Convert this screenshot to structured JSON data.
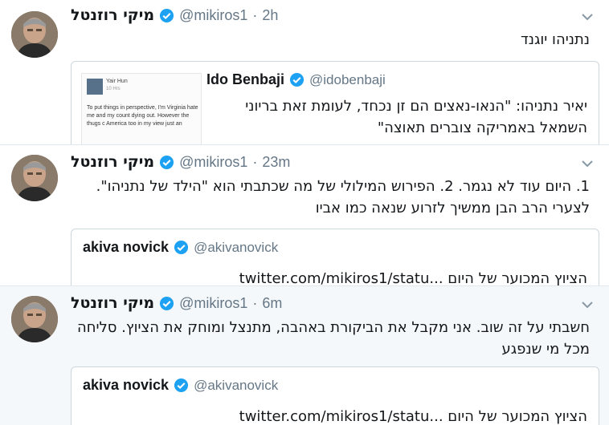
{
  "tweets": [
    {
      "author_name": "מיקי רוזנטל",
      "handle": "@mikiros1",
      "separator": "·",
      "time": "2h",
      "text": "נתניהו יוגנד",
      "quote": {
        "name": "Ido Benbaji",
        "handle": "@idobenbaji",
        "text": "יאיר נתניהו: \"הנאו-נאצים הם זן נכחד, לעומת זאת בריוני השמאל באמריקה צוברים תאוצה\"",
        "thumb": {
          "name": "Yair Hun",
          "sub": "10 Hrs",
          "text": "To put things in perspective, I'm Virginia hate me and my count dying out. However the thugs c America too in my view just an"
        }
      }
    },
    {
      "author_name": "מיקי רוזנטל",
      "handle": "@mikiros1",
      "separator": "·",
      "time": "23m",
      "text": "1. היום עוד לא נגמר. 2. הפירוש המילולי של מה שכתבתי הוא \"הילד של נתניהו\". לצערי הרב הבן ממשיך לזרוע שנאה כמו אביו",
      "quote": {
        "name": "akiva novick",
        "handle": "@akivanovick",
        "text": "הציוץ המכוער של היום ...twitter.com/mikiros1/statu"
      }
    },
    {
      "author_name": "מיקי רוזנטל",
      "handle": "@mikiros1",
      "separator": "·",
      "time": "6m",
      "text": "חשבתי על זה שוב. אני מקבל את הביקורת באהבה, מתנצל ומוחק את הציוץ. סליחה מכל מי שנפגע",
      "quote": {
        "name": "akiva novick",
        "handle": "@akivanovick",
        "text": "הציוץ המכוער של היום ...twitter.com/mikiros1/statu"
      }
    }
  ],
  "colors": {
    "verified_blue": "#1da1f2",
    "muted_text": "#657786",
    "border": "#ccd6dd",
    "highlight_bg": "#f5f8fa"
  }
}
